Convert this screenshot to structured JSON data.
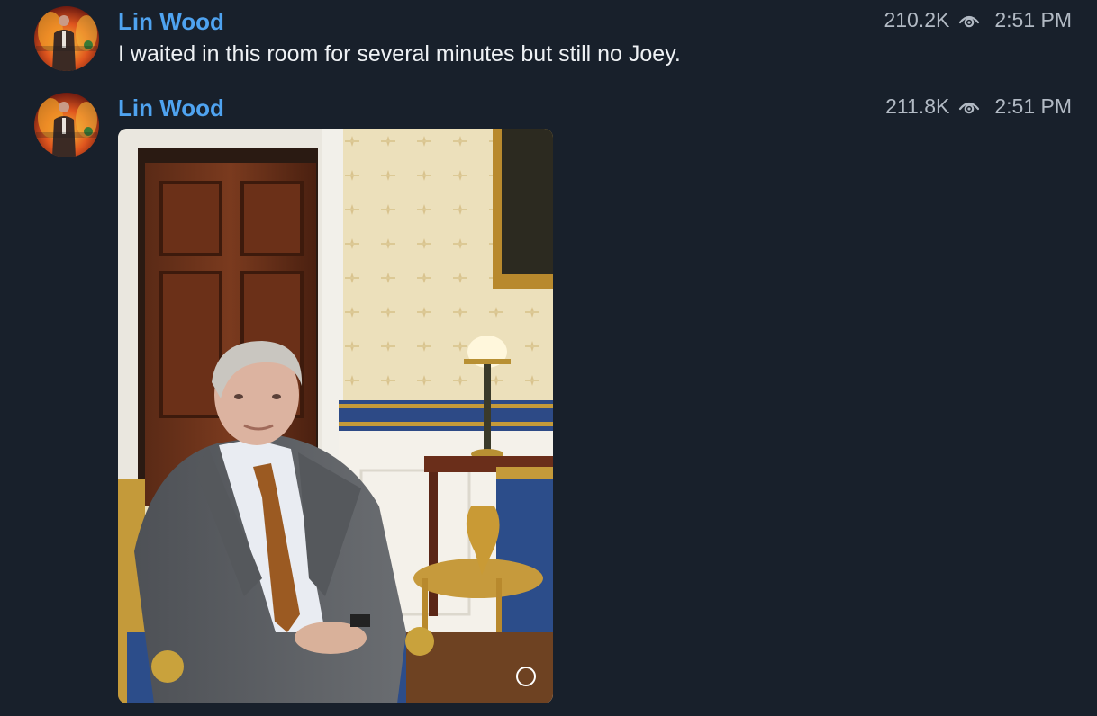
{
  "messages": [
    {
      "author": "Lin Wood",
      "views": "210.2K",
      "time": "2:51 PM",
      "text": "I waited in this room for several minutes but still no Joey.",
      "avatar_icon": "avatar-portrait"
    },
    {
      "author": "Lin Wood",
      "views": "211.8K",
      "time": "2:51 PM",
      "attachment": "photo",
      "avatar_icon": "avatar-portrait"
    }
  ],
  "icons": {
    "views": "eye-icon",
    "media_status": "circle-outline-icon"
  },
  "colors": {
    "background": "#18202b",
    "author": "#4fa3f0",
    "meta": "#b2bac4",
    "text": "#eef1f4"
  }
}
